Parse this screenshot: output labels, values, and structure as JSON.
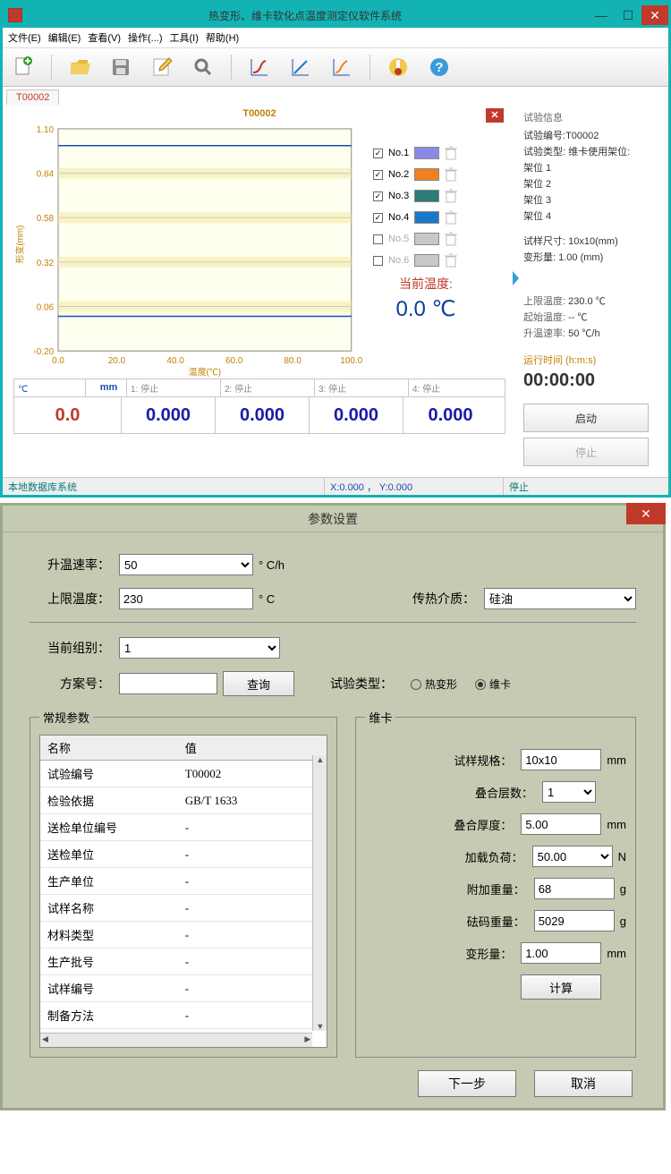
{
  "main_window": {
    "title": "热变形、维卡软化点温度测定仪软件系统",
    "menu": [
      "文件(E)",
      "编辑(E)",
      "查看(V)",
      "操作(...)",
      "工具(I)",
      "帮助(H)"
    ],
    "tab": "T00002",
    "chart_title": "T00002",
    "legend": [
      {
        "checked": true,
        "label": "No.1",
        "color": "#8a8ae6"
      },
      {
        "checked": true,
        "label": "No.2",
        "color": "#f08020"
      },
      {
        "checked": true,
        "label": "No.3",
        "color": "#2f7a7a"
      },
      {
        "checked": true,
        "label": "No.4",
        "color": "#1a78c8"
      },
      {
        "checked": false,
        "label": "No.5",
        "color": "#b8b8b8"
      },
      {
        "checked": false,
        "label": "No.6",
        "color": "#b8b8b8"
      }
    ],
    "cur_temp_label": "当前温度:",
    "cur_temp_value": "0.0 ℃",
    "right": {
      "header": "试验信息",
      "test_no_label": "试验编号:",
      "test_no": "T00002",
      "type_label": "试验类型: 维卡使用架位:",
      "slots": [
        "架位 1",
        "架位 2",
        "架位 3",
        "架位 4"
      ],
      "sample_size_label": "试样尺寸:",
      "sample_size": "10x10(mm)",
      "deform_label": "变形量:",
      "deform": "1.00 (mm)",
      "upper_label": "上限温度:",
      "upper": "230.0 ℃",
      "start_label": "起始温度:",
      "start": "-- ℃",
      "rate_label": "升温速率:",
      "rate": "50 ℃/h",
      "runtime_label": "运行时间 (h:m:s)",
      "runtime": "00:00:00",
      "start_btn": "启动",
      "stop_btn": "停止"
    },
    "strip": {
      "unit1": "℃",
      "unit2": "mm",
      "h1": "1: 停止",
      "h2": "2: 停止",
      "h3": "3: 停止",
      "h4": "4: 停止",
      "v_temp": "0.0",
      "v1": "0.000",
      "v2": "0.000",
      "v3": "0.000",
      "v4": "0.000"
    },
    "status": {
      "db": "本地数据库系统",
      "coords": "X:0.000 ， Y:0.000",
      "state": "停止"
    }
  },
  "chart_data": {
    "type": "line",
    "title": "T00002",
    "xlabel": "温度(℃)",
    "ylabel": "形变(mm)",
    "xlim": [
      0,
      100
    ],
    "ylim": [
      -0.2,
      1.1
    ],
    "xticks": [
      0.0,
      20.0,
      40.0,
      60.0,
      80.0,
      100.0
    ],
    "yticks": [
      -0.2,
      0.06,
      0.32,
      0.58,
      0.84,
      1.1
    ],
    "series": [
      {
        "name": "No.1",
        "color": "#8a8ae6",
        "x": [
          0,
          100
        ],
        "y": [
          1.0,
          1.0
        ]
      },
      {
        "name": "No.2",
        "color": "#f08020",
        "x": [
          0,
          100
        ],
        "y": [
          1.0,
          1.0
        ]
      },
      {
        "name": "No.3",
        "color": "#2f7a7a",
        "x": [
          0,
          100
        ],
        "y": [
          1.0,
          1.0
        ]
      },
      {
        "name": "No.4",
        "color": "#1a78c8",
        "x": [
          0,
          100
        ],
        "y": [
          0.0,
          0.0
        ]
      }
    ]
  },
  "dialog": {
    "title": "参数设置",
    "rate_label": "升温速率：",
    "rate_value": "50",
    "rate_unit": "° C/h",
    "upper_label": "上限温度：",
    "upper_value": "230",
    "upper_unit": "° C",
    "medium_label": "传热介质：",
    "medium_value": "硅油",
    "group_label": "当前组别：",
    "group_value": "1",
    "plan_label": "方案号：",
    "plan_value": "",
    "query_btn": "查询",
    "type_label": "试验类型：",
    "type_opts": [
      "热变形",
      "维卡"
    ],
    "type_selected": "维卡",
    "params_legend": "常规参数",
    "params_headers": [
      "名称",
      "值"
    ],
    "params": [
      {
        "n": "试验编号",
        "v": "T00002"
      },
      {
        "n": "检验依据",
        "v": "GB/T 1633"
      },
      {
        "n": "送检单位编号",
        "v": "-"
      },
      {
        "n": "送检单位",
        "v": "-"
      },
      {
        "n": "生产单位",
        "v": "-"
      },
      {
        "n": "试样名称",
        "v": "-"
      },
      {
        "n": "材料类型",
        "v": "-"
      },
      {
        "n": "生产批号",
        "v": "-"
      },
      {
        "n": "试样编号",
        "v": "-"
      },
      {
        "n": "制备方法",
        "v": "-"
      }
    ],
    "vk_legend": "维卡",
    "vk": {
      "spec_label": "试样规格：",
      "spec": "10x10",
      "spec_unit": "mm",
      "layers_label": "叠合层数：",
      "layers": "1",
      "thick_label": "叠合厚度：",
      "thick": "5.00",
      "thick_unit": "mm",
      "load_label": "加载负荷：",
      "load": "50.00",
      "load_unit": "N",
      "extra_label": "附加重量：",
      "extra": "68",
      "extra_unit": "g",
      "weight_label": "砝码重量：",
      "weight": "5029",
      "weight_unit": "g",
      "deform_label": "变形量：",
      "deform": "1.00",
      "deform_unit": "mm",
      "calc_btn": "计算"
    },
    "next_btn": "下一步",
    "cancel_btn": "取消"
  }
}
